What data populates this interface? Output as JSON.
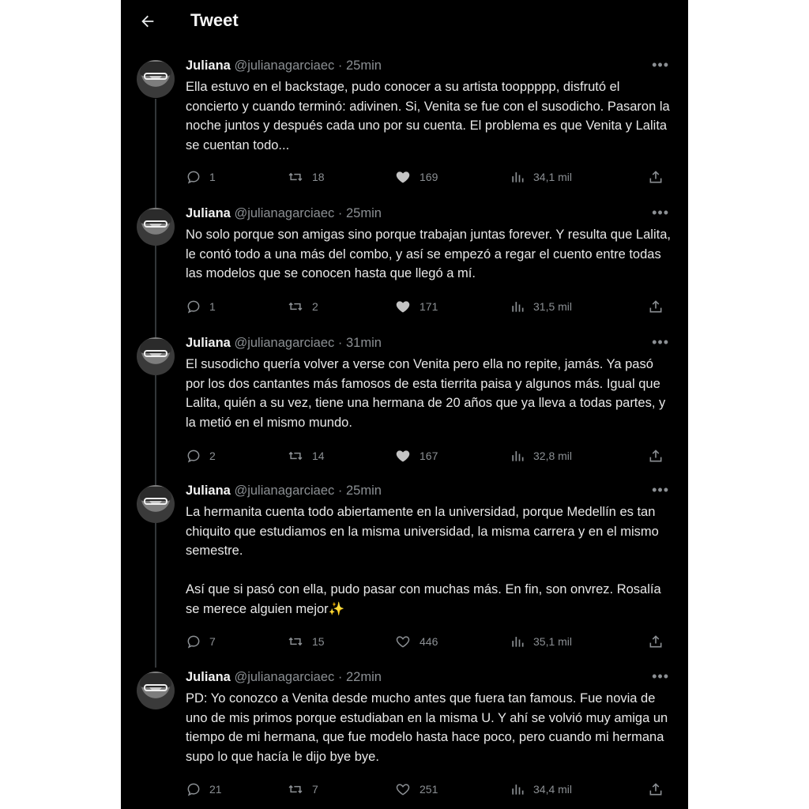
{
  "header": {
    "title": "Tweet"
  },
  "tweets": [
    {
      "name": "Juliana",
      "handle": "@julianagarciaec",
      "time": "25min",
      "text": "Ella estuvo en el backstage, pudo conocer a su artista tooppppp, disfrutó el concierto y cuando terminó: adivinen. Si, Venita se fue con el susodicho. Pasaron la noche juntos y después cada uno por su cuenta. El problema es que Venita y Lalita se cuentan todo...",
      "replies": "1",
      "retweets": "18",
      "likes": "169",
      "views": "34,1 mil",
      "liked": true
    },
    {
      "name": "Juliana",
      "handle": "@julianagarciaec",
      "time": "25min",
      "text": "No solo porque son amigas sino porque trabajan juntas forever. Y resulta que Lalita, le contó todo a una más del combo, y así se empezó a regar el cuento entre todas las modelos que se conocen hasta que llegó a mí.",
      "replies": "1",
      "retweets": "2",
      "likes": "171",
      "views": "31,5 mil",
      "liked": true
    },
    {
      "name": "Juliana",
      "handle": "@julianagarciaec",
      "time": "31min",
      "text": "El susodicho quería volver a verse con Venita pero ella no repite, jamás. Ya pasó por los dos cantantes más famosos de esta tierrita paisa y algunos más. Igual que Lalita, quién a su vez, tiene una hermana de 20 años que ya lleva a todas partes, y la metió en el mismo mundo.",
      "replies": "2",
      "retweets": "14",
      "likes": "167",
      "views": "32,8 mil",
      "liked": true
    },
    {
      "name": "Juliana",
      "handle": "@julianagarciaec",
      "time": "25min",
      "text": "La hermanita cuenta todo abiertamente en la universidad, porque Medellín es tan chiquito que estudiamos en la misma universidad, la misma carrera y en el mismo semestre.\n\nAsí que si pasó con ella, pudo pasar con muchas más. En fin, son onvrez. Rosalía se merece alguien mejor✨",
      "replies": "7",
      "retweets": "15",
      "likes": "446",
      "views": "35,1 mil",
      "liked": false
    },
    {
      "name": "Juliana",
      "handle": "@julianagarciaec",
      "time": "22min",
      "text": "PD: Yo conozco a Venita desde mucho antes que fuera tan famous. Fue novia de uno de mis primos porque estudiaban en la misma U. Y ahí se volvió muy amiga un tiempo de mi hermana, que fue modelo hasta hace poco, pero cuando mi hermana supo lo que hacía le dijo bye bye.",
      "replies": "21",
      "retweets": "7",
      "likes": "251",
      "views": "34,4 mil",
      "liked": false
    }
  ]
}
